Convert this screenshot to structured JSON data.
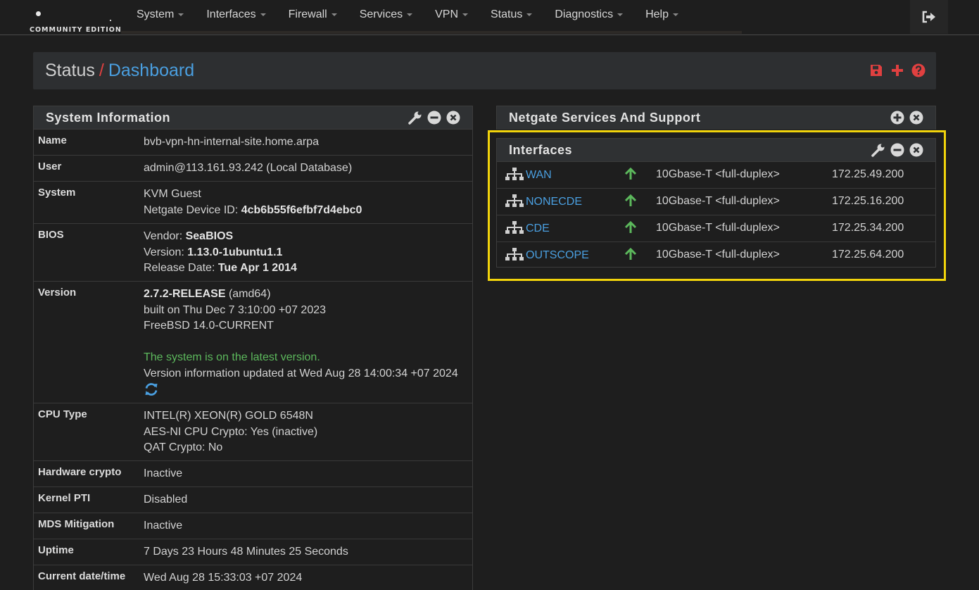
{
  "brand": {
    "edition": "COMMUNITY EDITION"
  },
  "nav": {
    "items": [
      {
        "label": "System"
      },
      {
        "label": "Interfaces"
      },
      {
        "label": "Firewall"
      },
      {
        "label": "Services"
      },
      {
        "label": "VPN"
      },
      {
        "label": "Status"
      },
      {
        "label": "Diagnostics"
      },
      {
        "label": "Help"
      }
    ],
    "logout_icon": "sign-out-icon"
  },
  "breadcrumb": {
    "section": "Status",
    "separator": "/",
    "page": "Dashboard",
    "actions": [
      "save-icon",
      "plus-icon",
      "help-icon"
    ]
  },
  "system_info": {
    "title": "System Information",
    "rows": {
      "name": {
        "label": "Name",
        "value": "bvb-vpn-hn-internal-site.home.arpa"
      },
      "user": {
        "label": "User",
        "value": "admin@113.161.93.242 (Local Database)"
      },
      "system": {
        "label": "System",
        "line1": "KVM Guest",
        "device_id_label": "Netgate Device ID:",
        "device_id": "4cb6b55f6efbf7d4ebc0"
      },
      "bios": {
        "label": "BIOS",
        "vendor_label": "Vendor:",
        "vendor": "SeaBIOS",
        "version_label": "Version:",
        "version": "1.13.0-1ubuntu1.1",
        "release_label": "Release Date:",
        "release": "Tue Apr 1 2014"
      },
      "version": {
        "label": "Version",
        "release": "2.7.2-RELEASE",
        "arch": "(amd64)",
        "built": "built on Thu Dec 7 3:10:00 +07 2023",
        "os": "FreeBSD 14.0-CURRENT",
        "status": "The system is on the latest version.",
        "updated": "Version information updated at Wed Aug 28 14:00:34 +07 2024"
      },
      "cpu": {
        "label": "CPU Type",
        "line1": "INTEL(R) XEON(R) GOLD 6548N",
        "line2": "AES-NI CPU Crypto: Yes (inactive)",
        "line3": "QAT Crypto: No"
      },
      "hw_crypto": {
        "label": "Hardware crypto",
        "value": "Inactive"
      },
      "pti": {
        "label": "Kernel PTI",
        "value": "Disabled"
      },
      "mds": {
        "label": "MDS Mitigation",
        "value": "Inactive"
      },
      "uptime": {
        "label": "Uptime",
        "value": "7 Days 23 Hours 48 Minutes 25 Seconds"
      },
      "datetime": {
        "label": "Current date/time",
        "value": "Wed Aug 28 15:33:03 +07 2024"
      }
    }
  },
  "netgate": {
    "title": "Netgate Services And Support"
  },
  "interfaces": {
    "title": "Interfaces",
    "rows": [
      {
        "name": "WAN",
        "status": "up",
        "media": "10Gbase-T <full-duplex>",
        "ip": "172.25.49.200"
      },
      {
        "name": "NONECDE",
        "status": "up",
        "media": "10Gbase-T <full-duplex>",
        "ip": "172.25.16.200"
      },
      {
        "name": "CDE",
        "status": "up",
        "media": "10Gbase-T <full-duplex>",
        "ip": "172.25.34.200"
      },
      {
        "name": "OUTSCOPE",
        "status": "up",
        "media": "10Gbase-T <full-duplex>",
        "ip": "172.25.64.200"
      }
    ]
  },
  "colors": {
    "link": "#4a9fe0",
    "danger": "#e04040",
    "success": "#5cb85c",
    "highlight": "#f2d40b"
  }
}
